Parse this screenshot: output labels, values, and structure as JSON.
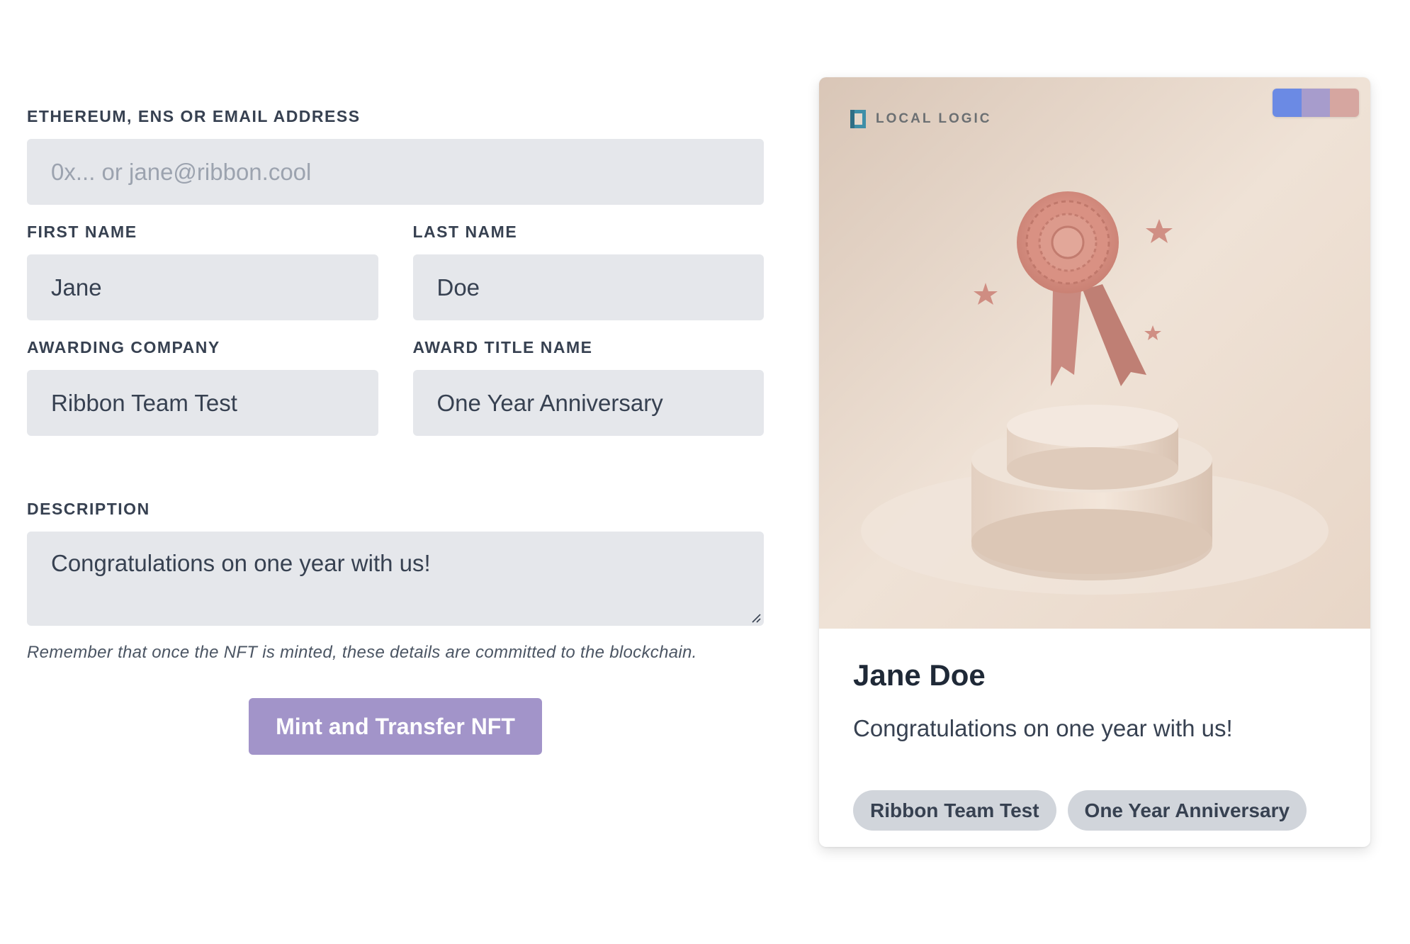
{
  "form": {
    "address_label": "ETHEREUM, ENS OR EMAIL ADDRESS",
    "address_placeholder": "0x... or jane@ribbon.cool",
    "first_name_label": "FIRST NAME",
    "first_name_value": "Jane",
    "last_name_label": "LAST NAME",
    "last_name_value": "Doe",
    "company_label": "AWARDING COMPANY",
    "company_value": "Ribbon Team Test",
    "award_title_label": "AWARD TITLE NAME",
    "award_title_value": "One Year Anniversary",
    "description_label": "DESCRIPTION",
    "description_value": "Congratulations on one year with us!",
    "note": "Remember that once the NFT is minted, these details are committed to the blockchain.",
    "submit_label": "Mint and Transfer NFT"
  },
  "card": {
    "logo_text": "LOCAL LOGIC",
    "name": "Jane Doe",
    "description": "Congratulations on one year with us!",
    "tags": [
      "Ribbon Team Test",
      "One Year Anniversary"
    ],
    "theme_swatches": [
      "#6b8ae4",
      "#a79ccc",
      "#d6a6a0"
    ]
  },
  "colors": {
    "accent": "#a294c9",
    "field_bg": "#e5e7eb",
    "tag_bg": "#d1d5db"
  }
}
